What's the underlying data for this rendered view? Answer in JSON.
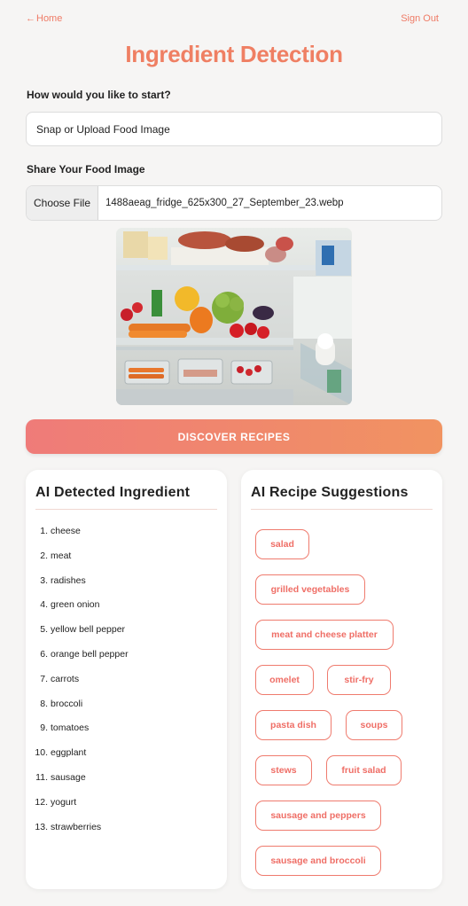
{
  "nav": {
    "home_label": "Home",
    "signout_label": "Sign Out"
  },
  "page": {
    "title": "Ingredient Detection"
  },
  "start": {
    "label": "How would you like to start?",
    "selected": "Snap or Upload Food Image"
  },
  "upload": {
    "label": "Share Your Food Image",
    "button_label": "Choose File",
    "file_name": "1488aeag_fridge_625x300_27_September_23.webp"
  },
  "action": {
    "discover_label": "DISCOVER RECIPES"
  },
  "ingredients": {
    "title": "AI Detected Ingredient",
    "items": [
      "cheese",
      "meat",
      "radishes",
      "green onion",
      "yellow bell pepper",
      "orange bell pepper",
      "carrots",
      "broccoli",
      "tomatoes",
      "eggplant",
      "sausage",
      "yogurt",
      "strawberries"
    ]
  },
  "recipes": {
    "title": "AI Recipe Suggestions",
    "items": [
      "salad",
      "grilled vegetables",
      "meat and cheese platter",
      "omelet",
      "stir-fry",
      "pasta dish",
      "soups",
      "stews",
      "fruit salad",
      "sausage and peppers",
      "sausage and broccoli"
    ]
  },
  "colors": {
    "accent": "#ef7f63",
    "chip_border": "#ef7b6e",
    "button_gradient_start": "#ef7b79",
    "button_gradient_end": "#f19361"
  }
}
